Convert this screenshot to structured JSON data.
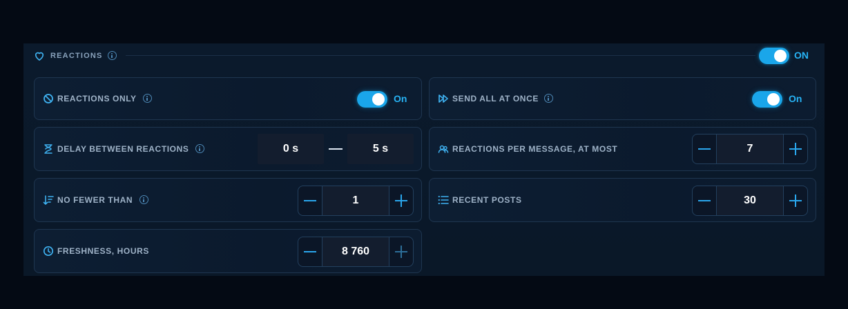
{
  "section": {
    "title": "REACTIONS",
    "toggle_label": "ON",
    "enabled": true
  },
  "settings": {
    "reactions_only": {
      "label": "REACTIONS ONLY",
      "toggle_label": "On",
      "enabled": true
    },
    "send_all_at_once": {
      "label": "SEND ALL AT ONCE",
      "toggle_label": "On",
      "enabled": true
    },
    "delay_between_reactions": {
      "label": "DELAY BETWEEN REACTIONS",
      "min": "0 s",
      "max": "5 s"
    },
    "reactions_per_message": {
      "label": "REACTIONS PER MESSAGE, AT MOST",
      "value": "7"
    },
    "no_fewer_than": {
      "label": "NO FEWER THAN",
      "value": "1"
    },
    "recent_posts": {
      "label": "RECENT POSTS",
      "value": "30"
    },
    "freshness_hours": {
      "label": "FRESHNESS, HOURS",
      "value": "8 760"
    }
  },
  "colors": {
    "accent": "#1aa6ea",
    "background": "#040a14",
    "panel": "#0b1a2c",
    "card_border": "#1f3650"
  },
  "icons": {
    "section": "heart-icon",
    "reactions_only": "block-icon",
    "send_all_at_once": "fast-forward-icon",
    "delay": "hourglass-icon",
    "per_message": "users-icon",
    "no_fewer_than": "sort-descending-icon",
    "recent_posts": "list-icon",
    "freshness": "clock-icon"
  }
}
